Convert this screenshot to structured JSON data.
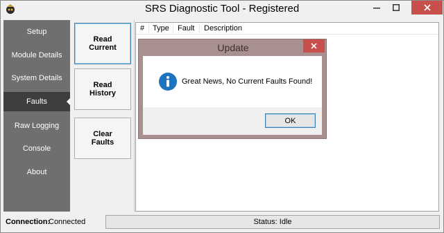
{
  "window": {
    "title": "SRS Diagnostic Tool - Registered",
    "icon": "app-logo-icon",
    "controls": [
      "minimize-icon",
      "maximize-icon",
      "close-icon"
    ]
  },
  "sidebar": {
    "items": [
      {
        "label": "Setup",
        "active": false
      },
      {
        "label": "Module Details",
        "active": false
      },
      {
        "label": "System Details",
        "active": false
      },
      {
        "label": "Faults",
        "active": true
      },
      {
        "label": "Raw Logging",
        "active": false
      },
      {
        "label": "Console",
        "active": false
      },
      {
        "label": "About",
        "active": false
      }
    ]
  },
  "actions": {
    "read_current": "Read\nCurrent",
    "read_history": "Read\nHistory",
    "clear_faults": "Clear\nFaults"
  },
  "faults_table": {
    "columns": [
      "#",
      "Type",
      "Fault",
      "Description"
    ],
    "rows": []
  },
  "status_bar": {
    "connection_label": "Connection:",
    "connection_value": "Connected",
    "status": "Status: Idle"
  },
  "dialog": {
    "title": "Update",
    "icon": "info-icon",
    "message": "Great News, No Current Faults Found!",
    "ok_label": "OK"
  },
  "colors": {
    "sidebar_bg": "#6f6f6f",
    "sidebar_active": "#3e3e3e",
    "close_button": "#c7504d",
    "dialog_frame": "#a89090",
    "info_blue": "#1e73be"
  }
}
